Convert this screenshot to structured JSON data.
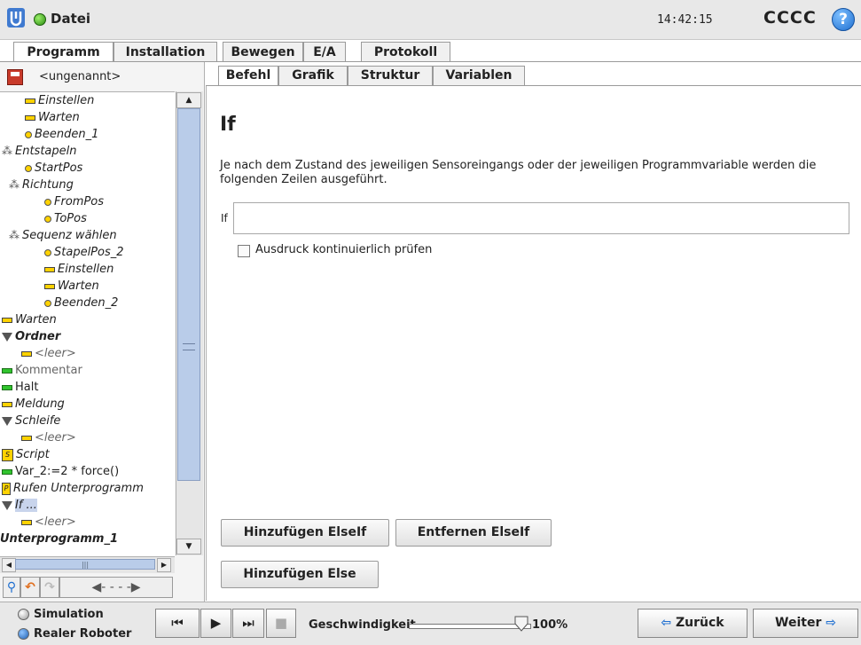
{
  "header": {
    "file_label": "Datei",
    "clock": "14:42:15",
    "robot_name": "CCCC",
    "help_symbol": "?"
  },
  "main_tabs": [
    {
      "label": "Programm",
      "active": true
    },
    {
      "label": "Installation",
      "active": false
    },
    {
      "label": "Bewegen",
      "active": false
    },
    {
      "label": "E/A",
      "active": false
    },
    {
      "label": "Protokoll",
      "active": false
    }
  ],
  "program": {
    "name": "<ungenannt>"
  },
  "tree": [
    {
      "label": "Einstellen",
      "icon": "bar",
      "style": "italic"
    },
    {
      "label": "Warten",
      "icon": "bar",
      "style": "italic"
    },
    {
      "label": "Beenden_1",
      "icon": "dot",
      "style": "italic"
    },
    {
      "label": "Entstapeln",
      "icon": "dots",
      "style": "italic"
    },
    {
      "label": "StartPos",
      "icon": "dot",
      "style": "italic"
    },
    {
      "label": "Richtung",
      "icon": "dots",
      "style": "italic"
    },
    {
      "label": "FromPos",
      "icon": "dot",
      "style": "italic"
    },
    {
      "label": "ToPos",
      "icon": "dot",
      "style": "italic"
    },
    {
      "label": "Sequenz wählen",
      "icon": "dots",
      "style": "italic"
    },
    {
      "label": "StapelPos_2",
      "icon": "dot",
      "style": "italic"
    },
    {
      "label": "Einstellen",
      "icon": "bar",
      "style": "italic"
    },
    {
      "label": "Warten",
      "icon": "bar",
      "style": "italic"
    },
    {
      "label": "Beenden_2",
      "icon": "dot",
      "style": "italic"
    },
    {
      "label": "Warten",
      "icon": "bar",
      "style": "italic"
    },
    {
      "label": "Ordner",
      "icon": "tri",
      "style": "bolditalic"
    },
    {
      "label": "<leer>",
      "icon": "bar",
      "style": "italic-gray"
    },
    {
      "label": "Kommentar",
      "icon": "green",
      "style": "gray"
    },
    {
      "label": "Halt",
      "icon": "green",
      "style": "normal"
    },
    {
      "label": "Meldung",
      "icon": "bar",
      "style": "italic"
    },
    {
      "label": "Schleife",
      "icon": "tri",
      "style": "italic"
    },
    {
      "label": "<leer>",
      "icon": "bar",
      "style": "italic-gray"
    },
    {
      "label": "Script",
      "icon": "script",
      "style": "italic"
    },
    {
      "label": "Var_2:=2 * force()",
      "icon": "green",
      "style": "normal"
    },
    {
      "label": "Rufen Unterprogramm",
      "icon": "p",
      "style": "italic"
    },
    {
      "label": "If ...",
      "icon": "tri",
      "style": "italic-hl"
    },
    {
      "label": "<leer>",
      "icon": "bar",
      "style": "italic-gray"
    },
    {
      "label": "Unterprogramm_1",
      "icon": "none",
      "style": "bolditalic"
    }
  ],
  "tree_scroll": {
    "hthumb_symbol": "|||"
  },
  "sub_tabs": [
    {
      "label": "Befehl",
      "active": true
    },
    {
      "label": "Grafik",
      "active": false
    },
    {
      "label": "Struktur",
      "active": false
    },
    {
      "label": "Variablen",
      "active": false
    }
  ],
  "command": {
    "title": "If",
    "description": "Je nach dem Zustand des jeweiligen Sensoreingangs oder der jeweiligen Programmvariable werden die folgenden Zeilen ausgeführt.",
    "if_label": "If",
    "if_value": "",
    "checkbox_label": "Ausdruck kontinuierlich prüfen",
    "checkbox_checked": false,
    "add_elseif": "Hinzufügen ElseIf",
    "remove_elseif": "Entfernen ElseIf",
    "add_else": "Hinzufügen Else"
  },
  "footer": {
    "simulation": "Simulation",
    "real_robot": "Realer Roboter",
    "speed_label": "Geschwindigkeit",
    "speed_value": "100%",
    "speed_fraction": 1.0,
    "back": "Zurück",
    "next": "Weiter"
  },
  "colors": {
    "accent_blue": "#1f6fd0",
    "status_green": "#2a8c12",
    "node_yellow": "#ffd200",
    "node_green": "#31c42e"
  }
}
